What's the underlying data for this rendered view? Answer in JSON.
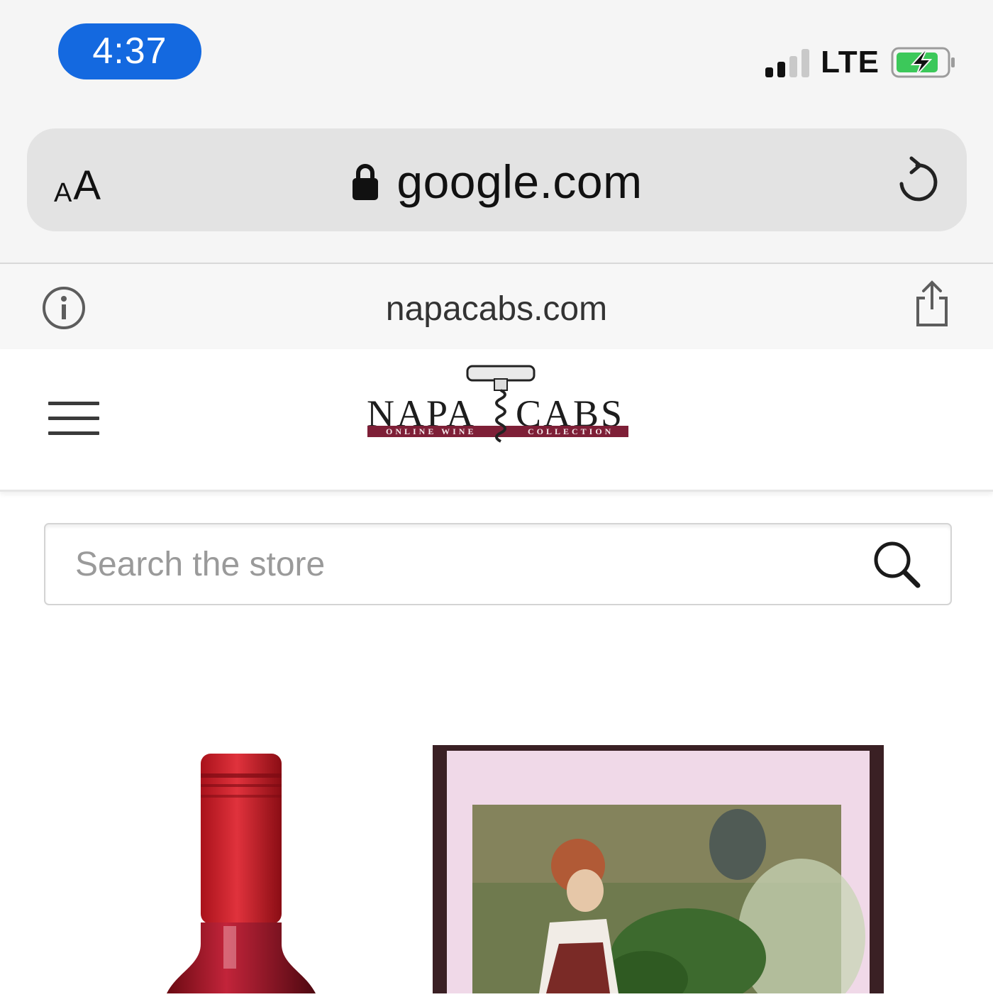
{
  "status_bar": {
    "time": "4:37",
    "network": "LTE",
    "time_pill_color": "#1469e0",
    "battery_color": "#3cc85a"
  },
  "browser": {
    "text_size_label_small": "A",
    "text_size_label_large": "A",
    "url": "google.com",
    "site_domain": "napacabs.com",
    "icons": [
      "lock-icon",
      "reload-icon",
      "info-icon",
      "share-icon"
    ]
  },
  "site": {
    "logo_left": "NAPA",
    "logo_right": "CABS",
    "logo_tag_left": "ONLINE WINE",
    "logo_tag_right": "COLLECTION",
    "brand_color": "#7e1f37",
    "menu_icon": "hamburger-menu-icon"
  },
  "search": {
    "placeholder": "Search the store",
    "icon": "search-icon"
  },
  "products": [
    {
      "image": "red-wine-bottle"
    },
    {
      "image": "painted-wine-label"
    }
  ]
}
